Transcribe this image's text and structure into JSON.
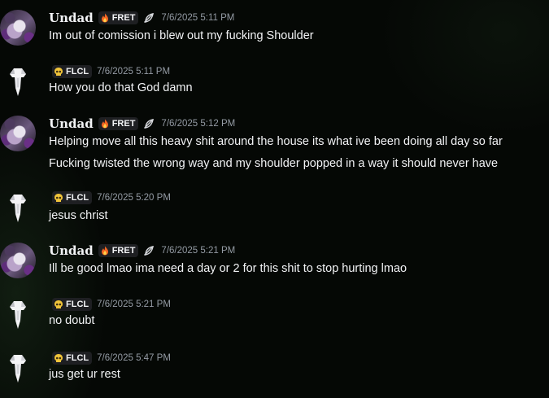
{
  "messages": [
    {
      "user": "Undad",
      "tag": "FRET",
      "time": "7/6/2025 5:11 PM",
      "lines": [
        "Im out of comission i blew out my fucking Shoulder"
      ]
    },
    {
      "user": "",
      "tag": "FLCL",
      "time": "7/6/2025 5:11 PM",
      "lines": [
        "How you do that God damn"
      ]
    },
    {
      "user": "Undad",
      "tag": "FRET",
      "time": "7/6/2025 5:12 PM",
      "lines": [
        "Helping move all this heavy shit around the house its what ive been doing all day so far",
        "Fucking twisted the wrong way and my shoulder popped in a way it should never have"
      ]
    },
    {
      "user": "",
      "tag": "FLCL",
      "time": "7/6/2025 5:20 PM",
      "lines": [
        "jesus christ"
      ]
    },
    {
      "user": "Undad",
      "tag": "FRET",
      "time": "7/6/2025 5:21 PM",
      "lines": [
        "Ill be good lmao ima need a day or 2 for this shit to stop hurting lmao"
      ]
    },
    {
      "user": "",
      "tag": "FLCL",
      "time": "7/6/2025 5:21 PM",
      "lines": [
        "no doubt"
      ]
    },
    {
      "user": "",
      "tag": "FLCL",
      "time": "7/6/2025 5:47 PM",
      "lines": [
        "jus get ur rest"
      ]
    }
  ],
  "icons": {
    "fret_tag": "fire-icon",
    "flcl_tag": "skull-icon",
    "undad_badge": "slash-leaf-icon",
    "flcl_avatar": "white-tower-icon"
  },
  "colors": {
    "background": "#050805",
    "text": "#f2f3f5",
    "timestamp": "#949ba4",
    "tag_bg": "#1e1f22",
    "fire": "#f26522",
    "skull": "#f0c43a"
  }
}
